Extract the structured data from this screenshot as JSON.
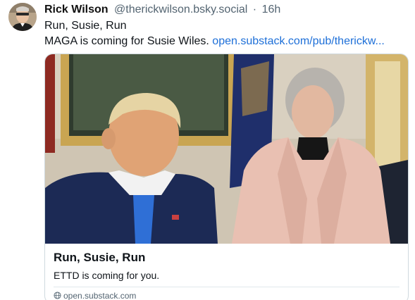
{
  "post": {
    "author": {
      "display_name": "Rick Wilson",
      "handle": "@therickwilson.bsky.social",
      "separator": "·",
      "timestamp": "16h"
    },
    "text_line1": "Run, Susie, Run",
    "text_line2_prefix": "MAGA is coming for Susie Wiles. ",
    "link_text": "open.substack.com/pub/therickw..."
  },
  "card": {
    "title": "Run, Susie, Run",
    "description": "ETTD is coming for you.",
    "domain": "open.substack.com",
    "domain_icon": "globe-icon"
  },
  "colors": {
    "link": "#1d6fd8",
    "secondary_text": "#536471",
    "border": "#cfd9de"
  }
}
